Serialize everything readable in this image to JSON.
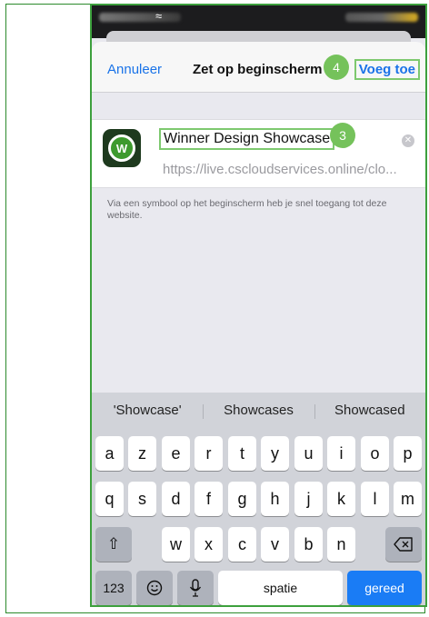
{
  "nav": {
    "cancel": "Annuleer",
    "title": "Zet op beginscherm",
    "add": "Voeg toe"
  },
  "badges": {
    "step_add": "4",
    "step_name": "3"
  },
  "card": {
    "app_icon_letter": "W",
    "name_value": "Winner Design Showcase",
    "url_value": "https://live.cscloudservices.online/clo..."
  },
  "info_text": "Via een symbool op het beginscherm heb je snel toegang tot deze website.",
  "keyboard": {
    "suggestions": [
      "'Showcase'",
      "Showcases",
      "Showcased"
    ],
    "row1": [
      "a",
      "z",
      "e",
      "r",
      "t",
      "y",
      "u",
      "i",
      "o",
      "p"
    ],
    "row2": [
      "q",
      "s",
      "d",
      "f",
      "g",
      "h",
      "j",
      "k",
      "l",
      "m"
    ],
    "row3": [
      "w",
      "x",
      "c",
      "v",
      "b",
      "n"
    ],
    "numbers_key": "123",
    "space_key": "spatie",
    "return_key": "gereed"
  },
  "icons": {
    "wifi": "wifi-icon",
    "clear": "clear-icon",
    "shift": "shift-icon",
    "delete": "delete-icon",
    "emoji": "emoji-icon",
    "microphone": "microphone-icon"
  },
  "colors": {
    "accent_blue": "#1a73e8",
    "annotation_green": "#75c25b",
    "return_key": "#1a7cf5"
  }
}
